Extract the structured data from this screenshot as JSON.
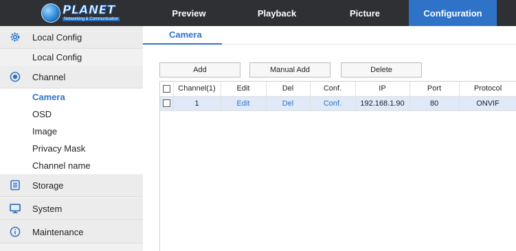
{
  "logo": {
    "brand": "PLANET",
    "tagline": "Networking & Communication"
  },
  "nav": {
    "tabs": [
      {
        "label": "Preview"
      },
      {
        "label": "Playback"
      },
      {
        "label": "Picture"
      },
      {
        "label": "Configuration",
        "active": true
      }
    ]
  },
  "sidebar": {
    "local_config": {
      "label": "Local Config",
      "icon": "gear-icon",
      "items": [
        {
          "label": "Local Config"
        }
      ]
    },
    "channel": {
      "label": "Channel",
      "icon": "camera-lens-icon",
      "items": [
        {
          "label": "Camera",
          "active": true
        },
        {
          "label": "OSD"
        },
        {
          "label": "Image"
        },
        {
          "label": "Privacy Mask"
        },
        {
          "label": "Channel name"
        }
      ]
    },
    "storage": {
      "label": "Storage",
      "icon": "storage-icon"
    },
    "system": {
      "label": "System",
      "icon": "monitor-icon"
    },
    "maintenance": {
      "label": "Maintenance",
      "icon": "info-icon"
    }
  },
  "main": {
    "tab_label": "Camera",
    "buttons": {
      "add": "Add",
      "manual_add": "Manual Add",
      "delete": "Delete"
    },
    "table": {
      "headers": [
        "Channel(1)",
        "Edit",
        "Del",
        "Conf.",
        "IP",
        "Port",
        "Protocol"
      ],
      "rows": [
        {
          "channel": "1",
          "edit": "Edit",
          "del": "Del",
          "conf": "Conf.",
          "ip": "192.168.1.90",
          "port": "80",
          "protocol": "ONVIF"
        }
      ]
    }
  },
  "colors": {
    "accent": "#2f73c9",
    "topbar": "#2e3033",
    "sidebar_bg": "#f1f1f1",
    "selected_row": "#dfe9f7"
  }
}
